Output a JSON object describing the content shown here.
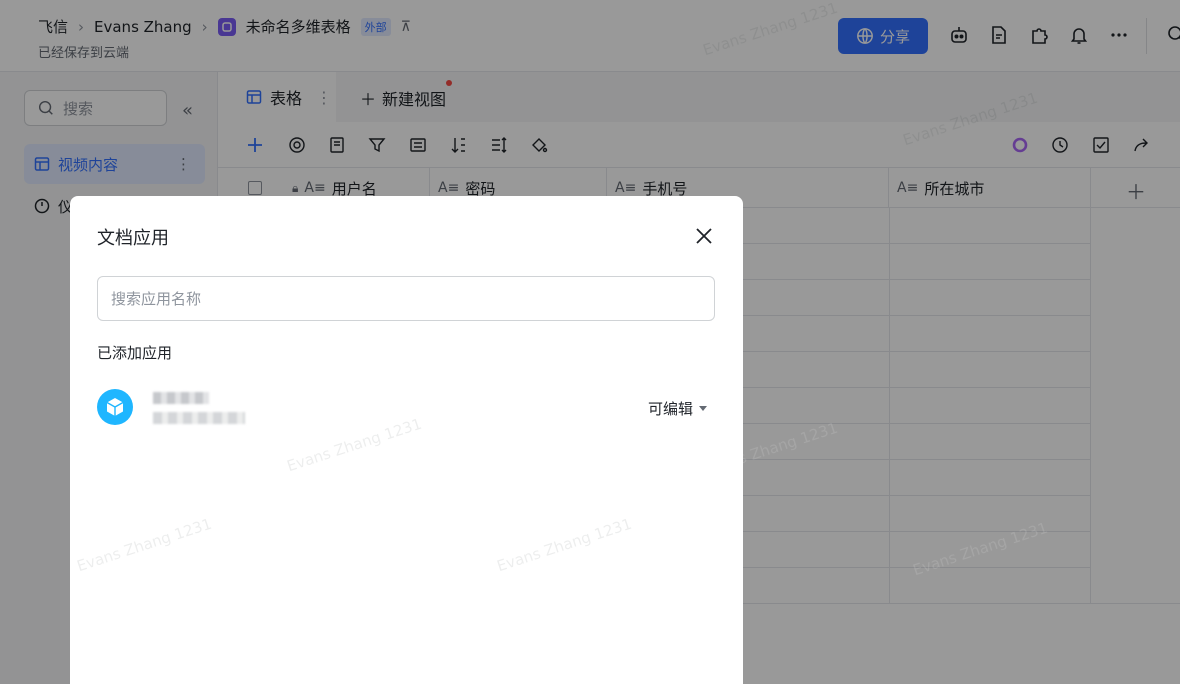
{
  "topbar": {
    "breadcrumb": [
      "飞信",
      "Evans Zhang",
      "未命名多维表格"
    ],
    "external_badge": "外部",
    "saved_status": "已经保存到云端",
    "share_label": "分享",
    "icons": [
      "robot-icon",
      "document-icon",
      "plugin-icon",
      "bell-icon",
      "more-icon",
      "search-icon"
    ]
  },
  "sidebar": {
    "search_placeholder": "搜索",
    "items": [
      {
        "label": "视频内容",
        "active": true
      },
      {
        "label": "仪",
        "active": false
      }
    ]
  },
  "views": {
    "tabs": [
      {
        "label": "表格"
      }
    ],
    "new_view_label": "新建视图"
  },
  "grid": {
    "columns": [
      "用户名",
      "密码",
      "手机号",
      "所在城市"
    ]
  },
  "watermark": "Evans Zhang 1231",
  "modal": {
    "title": "文档应用",
    "search_placeholder": "搜索应用名称",
    "section_label": "已添加应用",
    "apps": [
      {
        "permission": "可编辑"
      }
    ]
  },
  "colors": {
    "accent": "#3370ff",
    "app_icon": "#1fb6ff"
  }
}
